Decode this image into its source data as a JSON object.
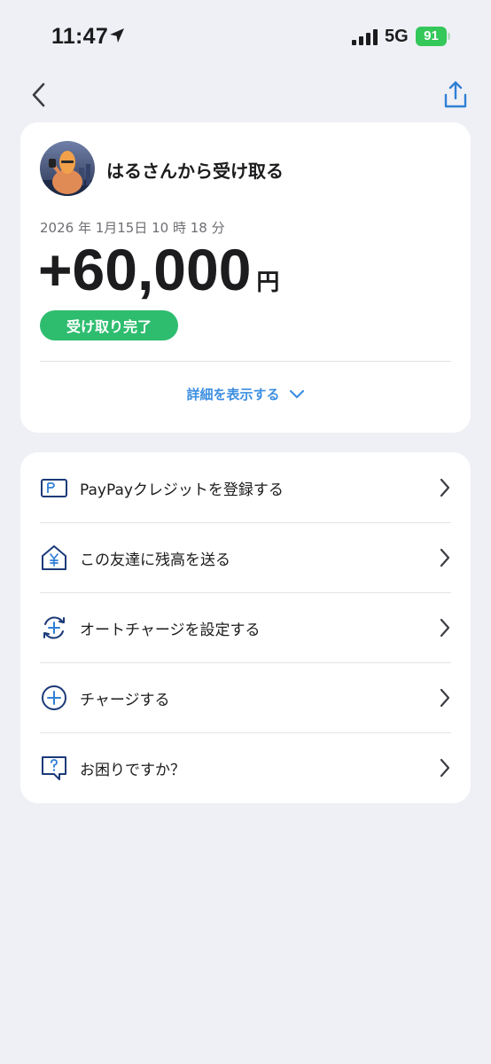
{
  "status_bar": {
    "time": "11:47",
    "network": "5G",
    "battery": "91"
  },
  "transaction": {
    "title": "はるさんから受け取る",
    "date": "2026 年 1月15日 10 時 18 分",
    "amount": "+60,000",
    "currency": "円",
    "status": "受け取り完了",
    "details_label": "詳細を表示する"
  },
  "menu": [
    {
      "label": "PayPayクレジットを登録する",
      "icon": "credit-card-icon"
    },
    {
      "label": "この友達に残高を送る",
      "icon": "send-balance-icon"
    },
    {
      "label": "オートチャージを設定する",
      "icon": "auto-charge-icon"
    },
    {
      "label": "チャージする",
      "icon": "charge-plus-icon"
    },
    {
      "label": "お困りですか？",
      "icon": "help-question-icon"
    }
  ],
  "colors": {
    "accent": "#3d8fe0",
    "success": "#2ebd6f",
    "icon_navy": "#1b3a78",
    "background": "#eff0f5"
  }
}
